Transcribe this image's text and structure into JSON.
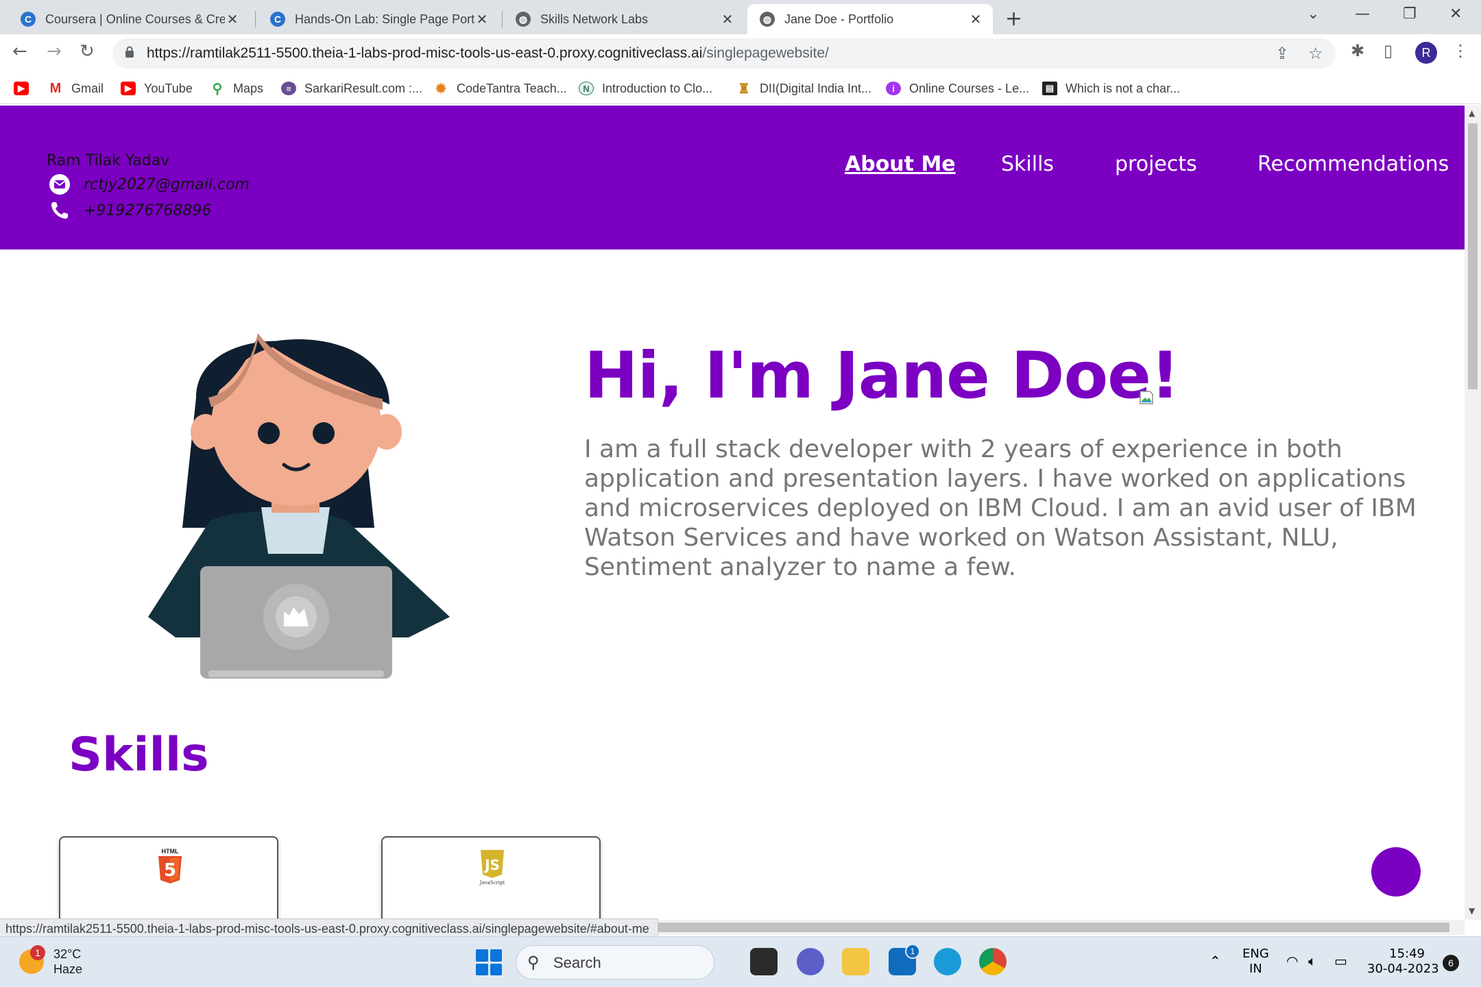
{
  "browser": {
    "tabs": [
      {
        "title": "Coursera | Online Courses & Cred",
        "icon": "coursera-icon"
      },
      {
        "title": "Hands-On Lab: Single Page Portfo",
        "icon": "coursera-icon"
      },
      {
        "title": "Skills Network Labs",
        "icon": "globe-icon"
      },
      {
        "title": "Jane Doe - Portfolio",
        "icon": "globe-icon",
        "active": true
      }
    ],
    "url_host": "https://ramtilak2511-5500.theia-1-labs-prod-misc-tools-us-east-0.proxy.cognitiveclass.ai",
    "url_path": "/singlepagewebsite/",
    "profile_initial": "R",
    "bookmarks": [
      {
        "label": "",
        "icon": "youtube-icon"
      },
      {
        "label": "Gmail",
        "icon": "gmail-icon"
      },
      {
        "label": "YouTube",
        "icon": "youtube-icon"
      },
      {
        "label": "Maps",
        "icon": "maps-icon"
      },
      {
        "label": "SarkariResult.com :...",
        "icon": "sarkari-icon"
      },
      {
        "label": "CodeTantra Teach...",
        "icon": "codetantra-icon"
      },
      {
        "label": "Introduction to Clo...",
        "icon": "n-icon"
      },
      {
        "label": "DII(Digital India Int...",
        "icon": "dii-icon"
      },
      {
        "label": "Online Courses - Le...",
        "icon": "udemy-icon"
      },
      {
        "label": "Which is not a char...",
        "icon": "page-icon"
      }
    ],
    "status_url": "https://ramtilak2511-5500.theia-1-labs-prod-misc-tools-us-east-0.proxy.cognitiveclass.ai/singlepagewebsite/#about-me"
  },
  "site": {
    "owner_name": "Ram Tilak Yadav",
    "email": "rctjy2027@gmail.com",
    "phone": "+919276768896",
    "nav": [
      "About Me",
      "Skills",
      "projects",
      "Recommendations"
    ],
    "active_nav": "About Me",
    "hero_title": "Hi, I'm Jane Doe!",
    "bio": "I am a full stack developer with 2 years of experience in both application and presentation layers. I have worked on applications and microservices deployed on IBM Cloud. I am an avid user of IBM Watson Services and have worked on Watson Assistant, NLU, Sentiment analyzer to name a few.",
    "skills_heading": "Skills",
    "skills": [
      {
        "logo_text": "HTML",
        "glyph": "5",
        "color": "#e44d26"
      },
      {
        "logo_text": "JavaScript",
        "glyph": "JS",
        "color": "#c9a227"
      }
    ],
    "accent_color": "#7b00c2"
  },
  "taskbar": {
    "temperature": "32°C",
    "weather": "Haze",
    "weather_badge": "1",
    "search_placeholder": "Search",
    "mail_badge": "1",
    "lang_top": "ENG",
    "lang_bottom": "IN",
    "time": "15:49",
    "date": "30-04-2023",
    "notifications": "6"
  }
}
